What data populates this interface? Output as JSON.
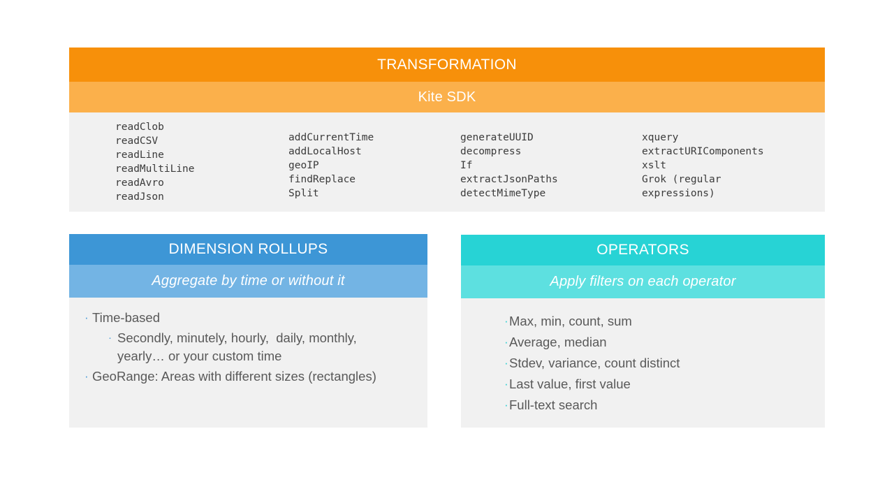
{
  "slide": {
    "background_color": "#ffffff"
  },
  "transformation": {
    "title": "TRANSFORMATION",
    "subtitle": "Kite SDK",
    "title_color": "#f7900a",
    "subtitle_color": "#fbb04b",
    "body_color": "#f1f1f1",
    "columns": [
      {
        "items": [
          "readClob",
          "readCSV",
          "readLine",
          "readMultiLine",
          "readAvro",
          "readJson"
        ],
        "text": "readClob\nreadCSV\nreadLine\nreadMultiLine\nreadAvro\nreadJson"
      },
      {
        "items": [
          "addCurrentTime",
          "addLocalHost",
          "geoIP",
          "findReplace",
          "Split"
        ],
        "text": "addCurrentTime\naddLocalHost\ngeoIP\nfindReplace\nSplit"
      },
      {
        "items": [
          "generateUUID",
          "decompress",
          "If",
          "extractJsonPaths",
          "detectMimeType"
        ],
        "text": "generateUUID\ndecompress\nIf\nextractJsonPaths\ndetectMimeType"
      },
      {
        "items": [
          "xquery",
          "extractURIComponents",
          "xslt",
          "Grok (regular",
          "expressions)"
        ],
        "text": "xquery\nextractURIComponents\nxslt\nGrok (regular\nexpressions)"
      }
    ]
  },
  "dimension_rollups": {
    "title": "DIMENSION ROLLUPS",
    "subtitle": "Aggregate by time or without it",
    "title_color": "#3d96d6",
    "subtitle_color": "#73b4e4",
    "body_color": "#f1f1f1",
    "bullet_color": "#4a9cd8",
    "bullet_glyph": "·",
    "items": [
      {
        "label": "Time-based",
        "sub_items": [
          "Secondly, minutely, hourly,  daily, monthly, yearly… or your custom time"
        ]
      },
      {
        "label": "GeoRange: Areas with different sizes (rectangles)",
        "sub_items": []
      }
    ]
  },
  "operators": {
    "title": "OPERATORS",
    "subtitle": "Apply filters on each operator",
    "title_color": "#27d3d5",
    "subtitle_color": "#5de0e0",
    "body_color": "#f1f1f1",
    "bullet_color": "#2fcfd2",
    "bullet_glyph": "·",
    "items": [
      "Max, min, count, sum",
      "Average, median",
      "Stdev, variance, count distinct",
      "Last value, first value",
      "Full-text search"
    ]
  }
}
